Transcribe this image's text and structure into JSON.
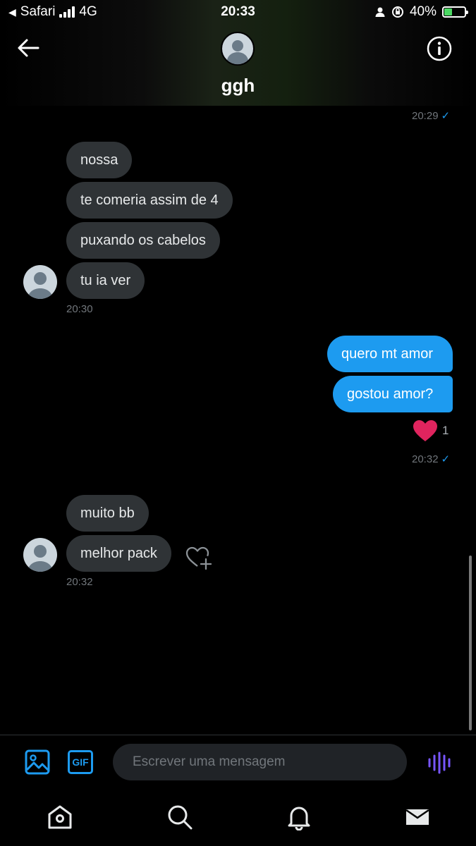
{
  "status_bar": {
    "back_app": "Safari",
    "network": "4G",
    "time": "20:33",
    "battery_percent": "40%",
    "battery_level": 0.4
  },
  "header": {
    "name": "ggh"
  },
  "messages": {
    "top_time": "20:29",
    "group1": {
      "m1": "nossa",
      "m2": "te comeria assim de 4",
      "m3": "puxando os cabelos",
      "m4": "tu ia ver",
      "time": "20:30"
    },
    "group2": {
      "m1": "quero mt amor",
      "m2": "gostou amor?",
      "reaction_count": "1",
      "time": "20:32"
    },
    "group3": {
      "m1": "muito bb",
      "m2": "melhor pack",
      "time": "20:32"
    },
    "read_check": "✓"
  },
  "composer": {
    "gif_label": "GIF",
    "placeholder": "Escrever uma mensagem"
  },
  "colors": {
    "accent": "#1d9bf0",
    "incoming_bubble": "#2f3336",
    "heart": "#f91880",
    "voice": "#7856ff"
  }
}
